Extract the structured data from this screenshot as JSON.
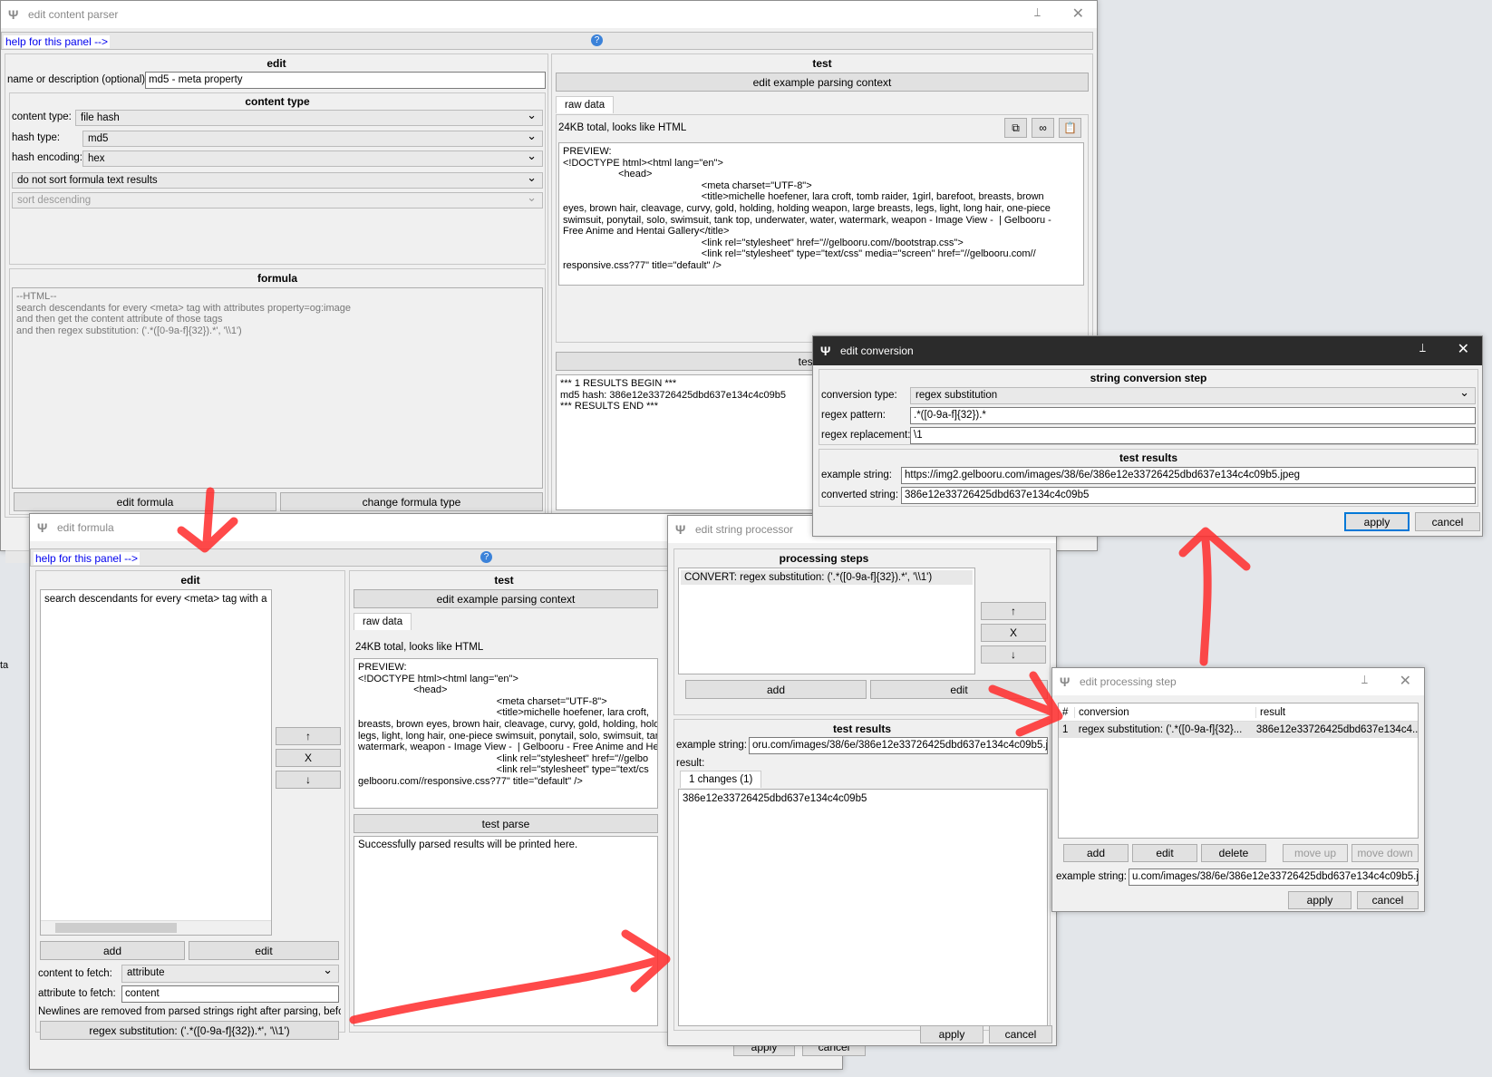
{
  "main": {
    "title": "edit content parser",
    "help": "help for this panel -->",
    "edit_header": "edit",
    "name_label": "name or description (optional):",
    "name_value": "md5 - meta property",
    "content_type_header": "content type",
    "content_type_label": "content type:",
    "content_type_value": "file hash",
    "hash_type_label": "hash type:",
    "hash_type_value": "md5",
    "hash_encoding_label": "hash encoding:",
    "hash_encoding_value": "hex",
    "sort_value": "do not sort formula text results",
    "sort_dir_value": "sort descending",
    "formula_header": "formula",
    "formula_text": "--HTML--\nsearch descendants for every <meta> tag with attributes property=og:image\nand then get the content attribute of those tags\nand then regex substitution: ('.*([0-9a-f]{32}).*', '\\\\1')",
    "edit_formula_btn": "edit formula",
    "change_formula_type_btn": "change formula type",
    "test_header": "test",
    "edit_context_btn": "edit example parsing context",
    "raw_tab": "raw data",
    "size_text": "24KB total, looks like HTML",
    "preview": "PREVIEW:\n<!DOCTYPE html><html lang=\"en\">\n                    <head>\n                                                  <meta charset=\"UTF-8\">\n                                                  <title>michelle hoefener, lara croft, tomb raider, 1girl, barefoot, breasts, brown\neyes, brown hair, cleavage, curvy, gold, holding, holding weapon, large breasts, legs, light, long hair, one-piece\nswimsuit, ponytail, solo, swimsuit, tank top, underwater, water, watermark, weapon - Image View -  | Gelbooru -\nFree Anime and Hentai Gallery</title>\n                                                  <link rel=\"stylesheet\" href=\"//gelbooru.com//bootstrap.css\">\n                                                  <link rel=\"stylesheet\" type=\"text/css\" media=\"screen\" href=\"//gelbooru.com//\nresponsive.css?77\" title=\"default\" />",
    "test_parse_btn": "test parse",
    "results": "*** 1 RESULTS BEGIN ***\nmd5 hash: 386e12e33726425dbd637e134c4c09b5\n*** RESULTS END ***",
    "cancel_partial": "ncel"
  },
  "formula": {
    "title": "edit formula",
    "help": "help for this panel -->",
    "edit_header": "edit",
    "list_item": "search descendants for every <meta> tag with a",
    "up": "↑",
    "x": "X",
    "down": "↓",
    "add_btn": "add",
    "edit_btn": "edit",
    "content_fetch_label": "content to fetch:",
    "content_fetch_value": "attribute",
    "attr_fetch_label": "attribute to fetch:",
    "attr_fetch_value": "content",
    "newline_note": "Newlines are removed from parsed strings right after parsing, befor...",
    "regex_btn": "regex substitution: ('.*([0-9a-f]{32}).*', '\\\\1')",
    "test_header": "test",
    "edit_context_btn": "edit example parsing context",
    "raw_tab": "raw data",
    "size_text": "24KB total, looks like HTML",
    "preview": "PREVIEW:\n<!DOCTYPE html><html lang=\"en\">\n                    <head>\n                                                  <meta charset=\"UTF-8\">\n                                                  <title>michelle hoefener, lara croft,\nbreasts, brown eyes, brown hair, cleavage, curvy, gold, holding, hold\nlegs, light, long hair, one-piece swimsuit, ponytail, solo, swimsuit, tank\nwatermark, weapon - Image View -  | Gelbooru - Free Anime and Hent\n                                                  <link rel=\"stylesheet\" href=\"//gelbo\n                                                  <link rel=\"stylesheet\" type=\"text/cs\ngelbooru.com//responsive.css?77\" title=\"default\" />",
    "test_parse_btn": "test parse",
    "results": "Successfully parsed results will be printed here.",
    "apply": "apply",
    "cancel": "cancel",
    "side_label": "ta"
  },
  "strproc": {
    "title": "edit string processor",
    "steps_header": "processing steps",
    "step_item": "CONVERT: regex substitution: ('.*([0-9a-f]{32}).*', '\\\\1')",
    "up": "↑",
    "x": "X",
    "down": "↓",
    "add_btn": "add",
    "edit_btn": "edit",
    "test_header": "test results",
    "example_label": "example string:",
    "example_value": "oru.com/images/38/6e/386e12e33726425dbd637e134c4c09b5.jpeg",
    "result_label": "result:",
    "changes_tab": "1 changes (1)",
    "result_value": "386e12e33726425dbd637e134c4c09b5",
    "apply": "apply",
    "cancel": "cancel"
  },
  "conversion": {
    "title": "edit conversion",
    "header": "string conversion step",
    "type_label": "conversion type:",
    "type_value": "regex substitution",
    "pattern_label": "regex pattern:",
    "pattern_value": ".*([0-9a-f]{32}).*",
    "replacement_label": "regex replacement:",
    "replacement_value": "\\1",
    "test_header": "test results",
    "example_label": "example string:",
    "example_value": "https://img2.gelbooru.com/images/38/6e/386e12e33726425dbd637e134c4c09b5.jpeg",
    "converted_label": "converted string:",
    "converted_value": "386e12e33726425dbd637e134c4c09b5",
    "apply": "apply",
    "cancel": "cancel"
  },
  "step": {
    "title": "edit processing step",
    "col_num": "#",
    "col_conv": "conversion",
    "col_result": "result",
    "row_num": "1",
    "row_conv": "regex substitution: ('.*([0-9a-f]{32}...",
    "row_result": "386e12e33726425dbd637e134c4...",
    "add_btn": "add",
    "edit_btn": "edit",
    "delete_btn": "delete",
    "move_up_btn": "move up",
    "move_down_btn": "move down",
    "example_label": "example string:",
    "example_value": "u.com/images/38/6e/386e12e33726425dbd637e134c4c09b5.jpeg",
    "apply": "apply",
    "cancel": "cancel"
  },
  "colors": {
    "arrow": "#ff2a2a",
    "active_titlebar": "#2b2b2b",
    "accent": "#0078d7"
  }
}
